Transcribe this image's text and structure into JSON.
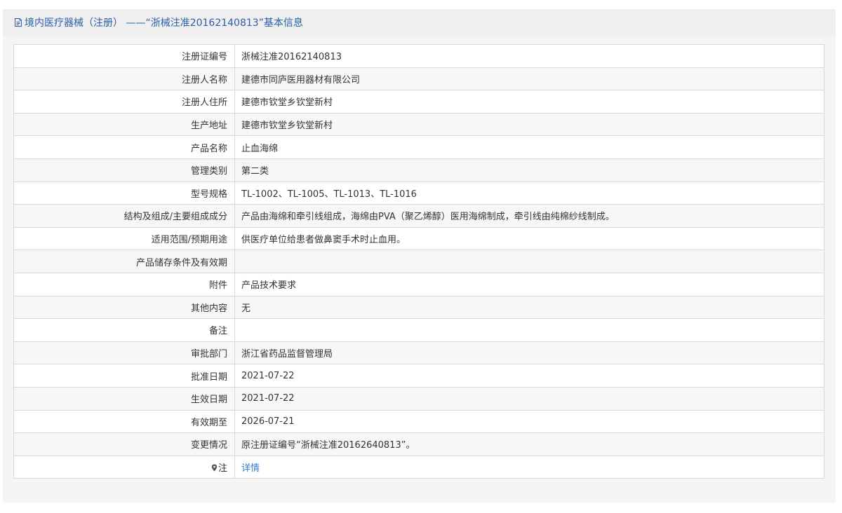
{
  "header": {
    "title": "境内医疗器械（注册） ——“浙械注准20162140813”基本信息"
  },
  "rows": [
    {
      "label": "注册证编号",
      "value": "浙械注准20162140813"
    },
    {
      "label": "注册人名称",
      "value": "建德市同庐医用器材有限公司"
    },
    {
      "label": "注册人住所",
      "value": "建德市钦堂乡钦堂新村"
    },
    {
      "label": "生产地址",
      "value": "建德市钦堂乡钦堂新村"
    },
    {
      "label": "产品名称",
      "value": "止血海绵"
    },
    {
      "label": "管理类别",
      "value": "第二类"
    },
    {
      "label": "型号规格",
      "value": "TL-1002、TL-1005、TL-1013、TL-1016"
    },
    {
      "label": "结构及组成/主要组成成分",
      "value": "产品由海绵和牵引线组成，海绵由PVA（聚乙烯醇）医用海绵制成，牵引线由纯棉纱线制成。"
    },
    {
      "label": "适用范围/预期用途",
      "value": "供医疗单位给患者做鼻窦手术时止血用。"
    },
    {
      "label": "产品储存条件及有效期",
      "value": ""
    },
    {
      "label": "附件",
      "value": "产品技术要求"
    },
    {
      "label": "其他内容",
      "value": "无"
    },
    {
      "label": "备注",
      "value": ""
    },
    {
      "label": "审批部门",
      "value": "浙江省药品监督管理局"
    },
    {
      "label": "批准日期",
      "value": "2021-07-22"
    },
    {
      "label": "生效日期",
      "value": "2021-07-22"
    },
    {
      "label": "有效期至",
      "value": "2026-07-21"
    },
    {
      "label": "变更情况",
      "value": "原注册证编号“浙械注准20162640813”。"
    }
  ],
  "note_row": {
    "label": "注",
    "link": "详情",
    "icon": "map-pin-icon"
  },
  "colors": {
    "header_text": "#2a5fa6",
    "link": "#2f7fd1",
    "border": "#d8d8d8"
  }
}
